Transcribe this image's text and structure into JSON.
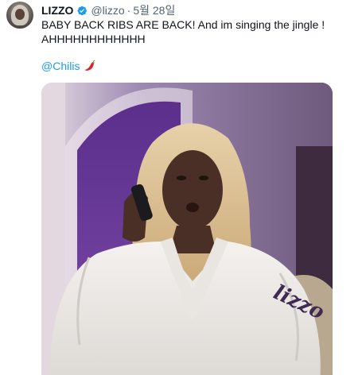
{
  "tweet": {
    "author": {
      "display_name": "LIZZO",
      "handle": "@lizzo",
      "verified": true
    },
    "separator": "·",
    "date": "5월 28일",
    "text": "BABY BACK RIBS ARE BACK! And im singing the jingle ! AHHHHHHHHHHHH",
    "mention": "@Chilis",
    "emoji": "chili-pepper",
    "media": {
      "type": "video-still",
      "robe_text": "lizzo"
    }
  },
  "colors": {
    "text": "#0f1419",
    "secondary": "#536471",
    "link": "#1d9bf0",
    "verified_badge": "#1d9bf0"
  }
}
